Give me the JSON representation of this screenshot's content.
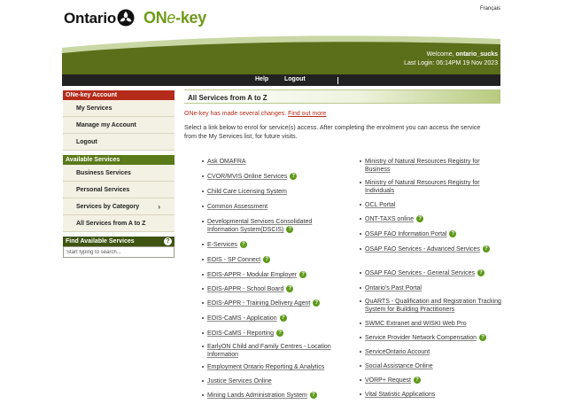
{
  "header": {
    "logo_text": "Ontario",
    "product_prefix": "ON",
    "product_e": "e",
    "product_suffix": "-key",
    "language_link": "Français",
    "welcome_prefix": "Welcome,",
    "username": "ontario_sucks",
    "last_login": "Last Login: 06:14PM 19 Nov 2023",
    "nav": {
      "help": "Help",
      "logout": "Logout"
    }
  },
  "sidebar": {
    "account_heading": "ONe-key Account",
    "account_items": [
      {
        "label": "My Services"
      },
      {
        "label": "Manage my Account"
      },
      {
        "label": "Logout"
      }
    ],
    "services_heading": "Available Services",
    "services_items": [
      {
        "label": "Business Services"
      },
      {
        "label": "Personal Services"
      },
      {
        "label": "Services by Category",
        "chevron": "›"
      },
      {
        "label": "All Services from A to Z"
      }
    ],
    "find_heading": "Find Available Services",
    "find_help": "?",
    "search_placeholder": "Start typing to search..."
  },
  "main": {
    "title": "All Services from A to Z",
    "notice_text": "ONe-key has made several changes.",
    "notice_link": "Find out more",
    "intro": "Select a link below to enrol for service(s) access. After completing the enrolment you can access the service from the My Services list, for future visits.",
    "left_services": [
      {
        "label": "Ask OMAFRA",
        "help": false
      },
      {
        "label": "CVOR/MVIS Online Services",
        "help": true
      },
      {
        "label": "Child Care Licensing System",
        "help": false
      },
      {
        "label": "Common Assessment",
        "help": false
      },
      {
        "label": "Developmental Services Consolidated Information System(DSCIS)",
        "help": true
      },
      {
        "label": "E-Services",
        "help": true
      },
      {
        "label": "EOIS - SP Connect",
        "help": true
      },
      {
        "label": "EOIS-APPR - Modular Employer",
        "help": true
      },
      {
        "label": "EOIS-APPR - School Board",
        "help": true
      },
      {
        "label": "EOIS-APPR - Training Delivery Agent",
        "help": true
      },
      {
        "label": "EOIS-CaMS - Application",
        "help": true
      },
      {
        "label": "EOIS-CaMS - Reporting",
        "help": true
      },
      {
        "label": "EarlyON Child and Family Centres - Location Information",
        "help": false
      },
      {
        "label": "Employment Ontario Reporting & Analytics",
        "help": false
      },
      {
        "label": "Justice Services Online",
        "help": false
      },
      {
        "label": "Mining Lands Administration System",
        "help": true
      }
    ],
    "right_services": [
      {
        "label": "Ministry of Natural Resources Registry for Business",
        "help": false
      },
      {
        "label": "Ministry of Natural Resources Registry for Individuals",
        "help": false
      },
      {
        "label": "OCL Portal",
        "help": false
      },
      {
        "label": "ONT-TAXS online",
        "help": true
      },
      {
        "label": "OSAP FAO Information Portal",
        "help": true
      },
      {
        "label": "OSAP FAO Services - Advanced Services",
        "help": true
      },
      {
        "label": "OSAP FAO Services - General Services",
        "help": true
      },
      {
        "label": "Ontario's Past Portal",
        "help": false
      },
      {
        "label": "QuARTS - Qualification and Registration Tracking System for Building Practitioners",
        "help": false
      },
      {
        "label": "SWMC Extranet and WISKI Web Pro",
        "help": false
      },
      {
        "label": "Service Provider Network Compensation",
        "help": true
      },
      {
        "label": "ServiceOntario Account",
        "help": false
      },
      {
        "label": "Social Assistance Online",
        "help": false
      },
      {
        "label": "VORP+ Request",
        "help": true
      },
      {
        "label": "Vital Statistic Applications",
        "help": false
      }
    ]
  },
  "colors": {
    "brand_green": "#6e9a17",
    "header_olive": "#5b6e1a",
    "nav_dark": "#222222",
    "accent_red": "#b52b1a",
    "help_green": "#5e9a1a"
  }
}
